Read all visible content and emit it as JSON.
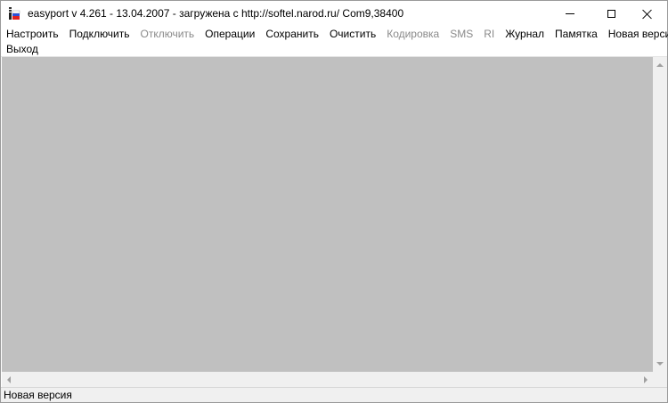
{
  "window": {
    "title": "easyport v 4.261 - 13.04.2007 -  загружена с http://softel.narod.ru/ Com9,38400",
    "icon": "easyport-app-icon",
    "controls": {
      "minimize_icon": "minimize-icon",
      "maximize_icon": "maximize-icon",
      "close_icon": "close-icon"
    }
  },
  "menu": {
    "items": [
      {
        "label": "Настроить",
        "enabled": true
      },
      {
        "label": "Подключить",
        "enabled": true
      },
      {
        "label": "Отключить",
        "enabled": false
      },
      {
        "label": "Операции",
        "enabled": true
      },
      {
        "label": "Сохранить",
        "enabled": true
      },
      {
        "label": "Очистить",
        "enabled": true
      },
      {
        "label": "Кодировка",
        "enabled": false
      },
      {
        "label": "SMS",
        "enabled": false
      },
      {
        "label": "RI",
        "enabled": false
      },
      {
        "label": "Журнал",
        "enabled": true
      },
      {
        "label": "Памятка",
        "enabled": true
      },
      {
        "label": "Новая версия",
        "enabled": true
      },
      {
        "label": "Выход",
        "enabled": true
      }
    ]
  },
  "client": {
    "background": "#c0c0c0"
  },
  "status": {
    "text": "Новая версия"
  }
}
